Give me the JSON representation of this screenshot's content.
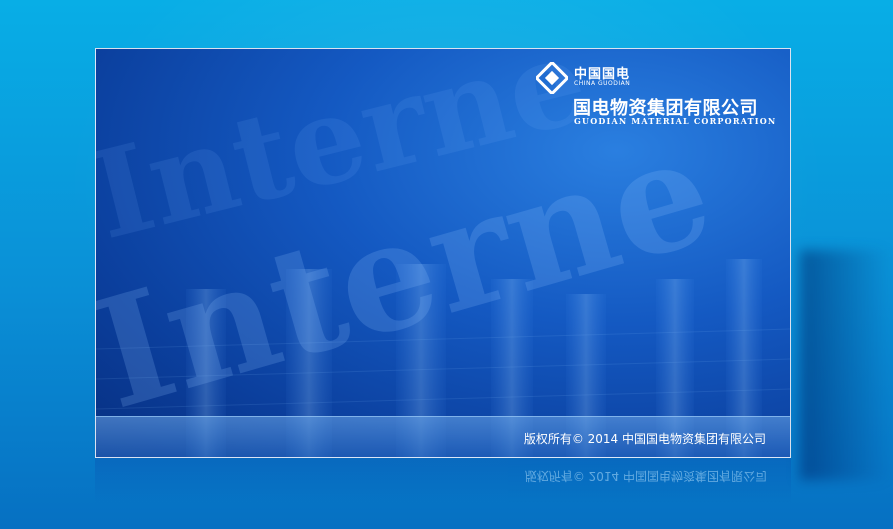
{
  "brand": {
    "cn_short": "中国国电",
    "en_short": "CHINA GUODIAN",
    "cn_full": "国电物资集团有限公司",
    "en_full": "GUODIAN MATERIAL CORPORATION"
  },
  "background": {
    "words": [
      "Interne",
      "Interne"
    ]
  },
  "footer": {
    "copyright": "版权所有© 2014 中国国电物资集团有限公司"
  },
  "colors": {
    "accent": "#1459c2",
    "outer": "#08aee6"
  },
  "icons": {
    "logo": "guodian-diamond-logo"
  }
}
